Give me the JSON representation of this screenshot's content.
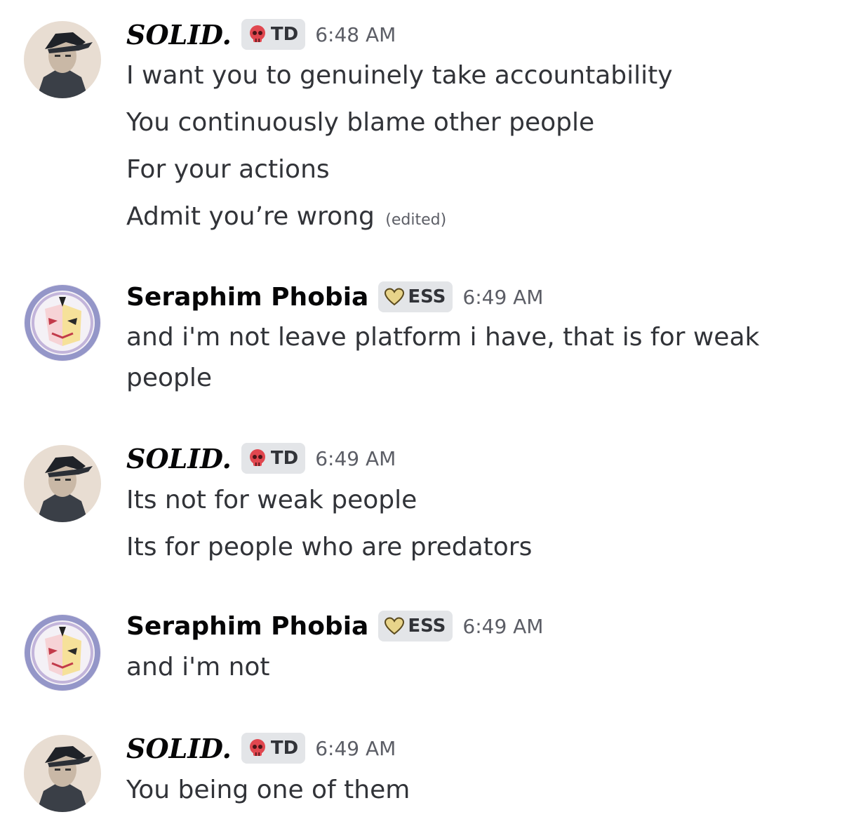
{
  "messages": [
    {
      "author": "SOLID.",
      "tag": "TD",
      "tag_icon": "skull-icon",
      "time": "6:48 AM",
      "lines": [
        "I want you to genuinely take accountability",
        "You continuously blame other people",
        "For your actions",
        "Admit you’re wrong"
      ],
      "edited": "(edited)"
    },
    {
      "author": "Seraphim Phobia",
      "tag": "ESS",
      "tag_icon": "heart-icon",
      "time": "6:49 AM",
      "lines": [
        "and i'm not leave platform i have, that is for weak people"
      ]
    },
    {
      "author": "SOLID.",
      "tag": "TD",
      "tag_icon": "skull-icon",
      "time": "6:49 AM",
      "lines": [
        "Its not for weak people",
        "Its for people who are predators"
      ]
    },
    {
      "author": "Seraphim Phobia",
      "tag": "ESS",
      "tag_icon": "heart-icon",
      "time": "6:49 AM",
      "lines": [
        "and i'm not"
      ]
    },
    {
      "author": "SOLID.",
      "tag": "TD",
      "tag_icon": "skull-icon",
      "time": "6:49 AM",
      "lines": [
        "You being one of them"
      ]
    }
  ],
  "colors": {
    "tag_bg": "#e3e5e8",
    "skull": "#e0474f",
    "heart": "#e8d48a",
    "timestamp": "#5c5e66"
  }
}
